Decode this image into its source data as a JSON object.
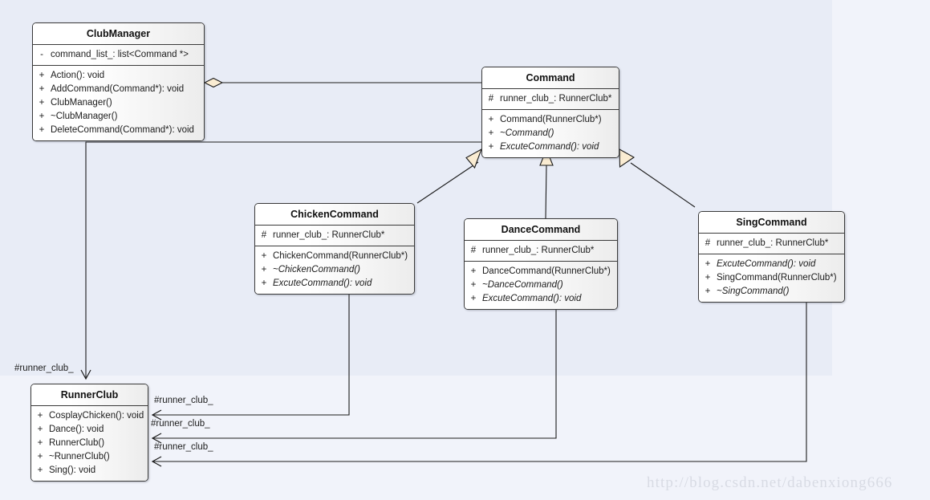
{
  "diagram": {
    "type": "uml-class-diagram",
    "background_color": "#e8ecf6",
    "panel_color": "#f1f3fa",
    "line_color": "#1b1b1b",
    "marker_fill": "#faecd2"
  },
  "classes": {
    "club_manager": {
      "name": "ClubManager",
      "attributes": [
        {
          "visibility": "-",
          "signature": "command_list_: list<Command *>",
          "abstract": false
        }
      ],
      "operations": [
        {
          "visibility": "+",
          "signature": "Action(): void",
          "abstract": false
        },
        {
          "visibility": "+",
          "signature": "AddCommand(Command*): void",
          "abstract": false
        },
        {
          "visibility": "+",
          "signature": "ClubManager()",
          "abstract": false
        },
        {
          "visibility": "+",
          "signature": "~ClubManager()",
          "abstract": false
        },
        {
          "visibility": "+",
          "signature": "DeleteCommand(Command*): void",
          "abstract": false
        }
      ]
    },
    "command": {
      "name": "Command",
      "attributes": [
        {
          "visibility": "#",
          "signature": "runner_club_: RunnerClub*",
          "abstract": false
        }
      ],
      "operations": [
        {
          "visibility": "+",
          "signature": "Command(RunnerClub*)",
          "abstract": false
        },
        {
          "visibility": "+",
          "signature": "~Command()",
          "abstract": true
        },
        {
          "visibility": "+",
          "signature": "ExcuteCommand(): void",
          "abstract": true
        }
      ]
    },
    "chicken_command": {
      "name": "ChickenCommand",
      "attributes": [
        {
          "visibility": "#",
          "signature": "runner_club_: RunnerClub*",
          "abstract": false
        }
      ],
      "operations": [
        {
          "visibility": "+",
          "signature": "ChickenCommand(RunnerClub*)",
          "abstract": false
        },
        {
          "visibility": "+",
          "signature": "~ChickenCommand()",
          "abstract": true
        },
        {
          "visibility": "+",
          "signature": "ExcuteCommand(): void",
          "abstract": true
        }
      ]
    },
    "dance_command": {
      "name": "DanceCommand",
      "attributes": [
        {
          "visibility": "#",
          "signature": "runner_club_: RunnerClub*",
          "abstract": false
        }
      ],
      "operations": [
        {
          "visibility": "+",
          "signature": "DanceCommand(RunnerClub*)",
          "abstract": false
        },
        {
          "visibility": "+",
          "signature": "~DanceCommand()",
          "abstract": true
        },
        {
          "visibility": "+",
          "signature": "ExcuteCommand(): void",
          "abstract": true
        }
      ]
    },
    "sing_command": {
      "name": "SingCommand",
      "attributes": [
        {
          "visibility": "#",
          "signature": "runner_club_: RunnerClub*",
          "abstract": false
        }
      ],
      "operations": [
        {
          "visibility": "+",
          "signature": "ExcuteCommand(): void",
          "abstract": true
        },
        {
          "visibility": "+",
          "signature": "SingCommand(RunnerClub*)",
          "abstract": false
        },
        {
          "visibility": "+",
          "signature": "~SingCommand()",
          "abstract": true
        }
      ]
    },
    "runner_club": {
      "name": "RunnerClub",
      "attributes": [],
      "operations": [
        {
          "visibility": "+",
          "signature": "CosplayChicken(): void",
          "abstract": false
        },
        {
          "visibility": "+",
          "signature": "Dance(): void",
          "abstract": false
        },
        {
          "visibility": "+",
          "signature": "RunnerClub()",
          "abstract": false
        },
        {
          "visibility": "+",
          "signature": "~RunnerClub()",
          "abstract": false
        },
        {
          "visibility": "+",
          "signature": "Sing(): void",
          "abstract": false
        }
      ]
    }
  },
  "relationships": {
    "aggregation": {
      "from": "ClubManager",
      "to": "Command",
      "kind": "aggregation"
    },
    "generalizations": [
      {
        "from": "ChickenCommand",
        "to": "Command"
      },
      {
        "from": "DanceCommand",
        "to": "Command"
      },
      {
        "from": "SingCommand",
        "to": "Command"
      }
    ],
    "associations": [
      {
        "from": "Command",
        "to": "RunnerClub",
        "label": "#runner_club_"
      },
      {
        "from": "ChickenCommand",
        "to": "RunnerClub",
        "label": "#runner_club_"
      },
      {
        "from": "DanceCommand",
        "to": "RunnerClub",
        "label": "#runner_club_"
      },
      {
        "from": "SingCommand",
        "to": "RunnerClub",
        "label": "#runner_club_"
      }
    ]
  },
  "edge_labels": {
    "command_to_runnerclub": "#runner_club_",
    "chicken_to_runnerclub": "#runner_club_",
    "dance_to_runnerclub": "#runner_club_",
    "sing_to_runnerclub": "#runner_club_"
  },
  "watermark": {
    "text": "http://blog.csdn.net/dabenxiong666"
  }
}
